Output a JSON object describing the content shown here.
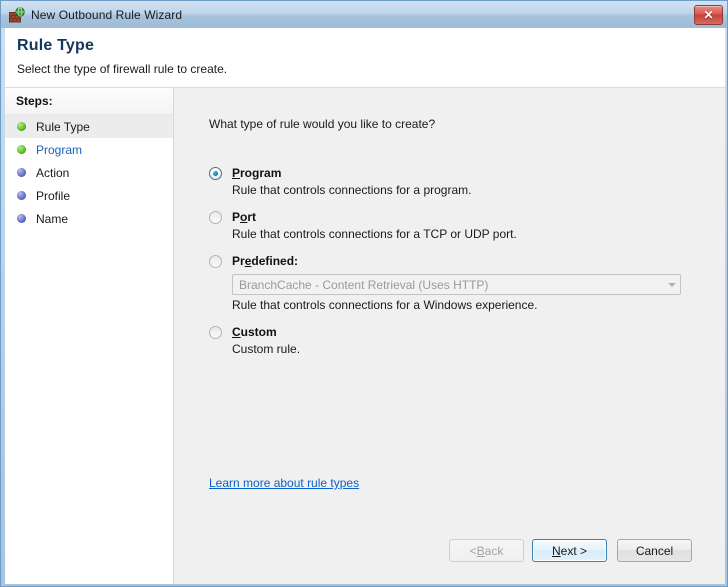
{
  "window": {
    "title": "New Outbound Rule Wizard",
    "title_icon": "firewall-globe-icon",
    "close_label": "✕"
  },
  "header": {
    "title": "Rule Type",
    "subtitle": "Select the type of firewall rule to create."
  },
  "sidebar": {
    "heading": "Steps:",
    "items": [
      {
        "label": "Rule Type",
        "bullet": "green",
        "state": "current"
      },
      {
        "label": "Program",
        "bullet": "green",
        "state": "link"
      },
      {
        "label": "Action",
        "bullet": "blue",
        "state": "pending"
      },
      {
        "label": "Profile",
        "bullet": "blue",
        "state": "pending"
      },
      {
        "label": "Name",
        "bullet": "blue",
        "state": "pending"
      }
    ]
  },
  "content": {
    "question": "What type of rule would you like to create?",
    "options": [
      {
        "id": "program",
        "title_pre": "",
        "accel": "P",
        "title_post": "rogram",
        "description": "Rule that controls connections for a program.",
        "checked": true
      },
      {
        "id": "port",
        "title_pre": "P",
        "accel": "o",
        "title_post": "rt",
        "description": "Rule that controls connections for a TCP or UDP port.",
        "checked": false
      },
      {
        "id": "predefined",
        "title_pre": "Pr",
        "accel": "e",
        "title_post": "defined:",
        "description": "Rule that controls connections for a Windows experience.",
        "checked": false,
        "combo": {
          "value": "BranchCache - Content Retrieval (Uses HTTP)",
          "disabled": true,
          "arrow_icon": "chevron-down-icon"
        }
      },
      {
        "id": "custom",
        "title_pre": "",
        "accel": "C",
        "title_post": "ustom",
        "description": "Custom rule.",
        "checked": false
      }
    ],
    "learn_more": "Learn more about rule types"
  },
  "footer": {
    "back_pre": "< ",
    "back_accel": "B",
    "back_post": "ack",
    "back_disabled": true,
    "next_pre": "",
    "next_accel": "N",
    "next_post": "ext >",
    "next_default": true,
    "cancel": "Cancel"
  },
  "colors": {
    "titlebar_top": "#d3e2f2",
    "titlebar_bottom": "#9fbcd8",
    "accent_link": "#0b63c6",
    "header_title": "#14355c",
    "content_bg": "#f0f0f0",
    "sidebar_bg": "#ffffff",
    "current_step_bg": "#ececec",
    "step_green": "#76d13f",
    "step_blue": "#7b84d4",
    "close_red": "#d9584f",
    "default_button_border": "#3c7fb1"
  }
}
